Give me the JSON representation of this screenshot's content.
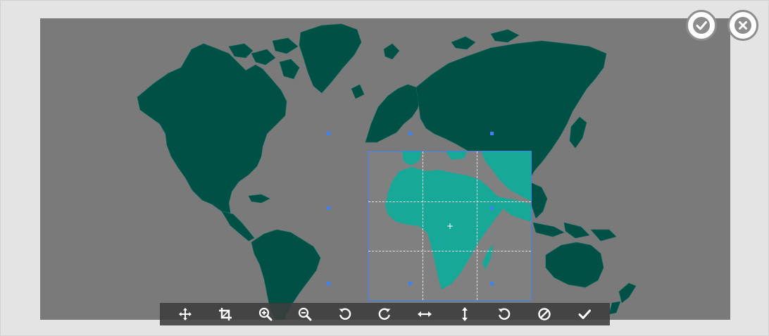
{
  "editor": {
    "confirm_icon": "check-circle-icon",
    "cancel_icon": "close-circle-icon",
    "colors": {
      "background": "#e4e4e4",
      "canvas": "#7a7a7a",
      "land_dim": "#005046",
      "land_selected": "#18a898",
      "selection_border": "#3b82f6",
      "toolbar": "#3c3c3c"
    }
  },
  "toolbar": {
    "tools": [
      {
        "name": "move-icon"
      },
      {
        "name": "crop-icon"
      },
      {
        "name": "zoom-in-icon"
      },
      {
        "name": "zoom-out-icon"
      },
      {
        "name": "rotate-left-icon"
      },
      {
        "name": "rotate-right-icon"
      },
      {
        "name": "flip-horizontal-icon"
      },
      {
        "name": "flip-vertical-icon"
      },
      {
        "name": "reset-icon"
      },
      {
        "name": "clear-icon"
      },
      {
        "name": "apply-icon"
      }
    ]
  }
}
